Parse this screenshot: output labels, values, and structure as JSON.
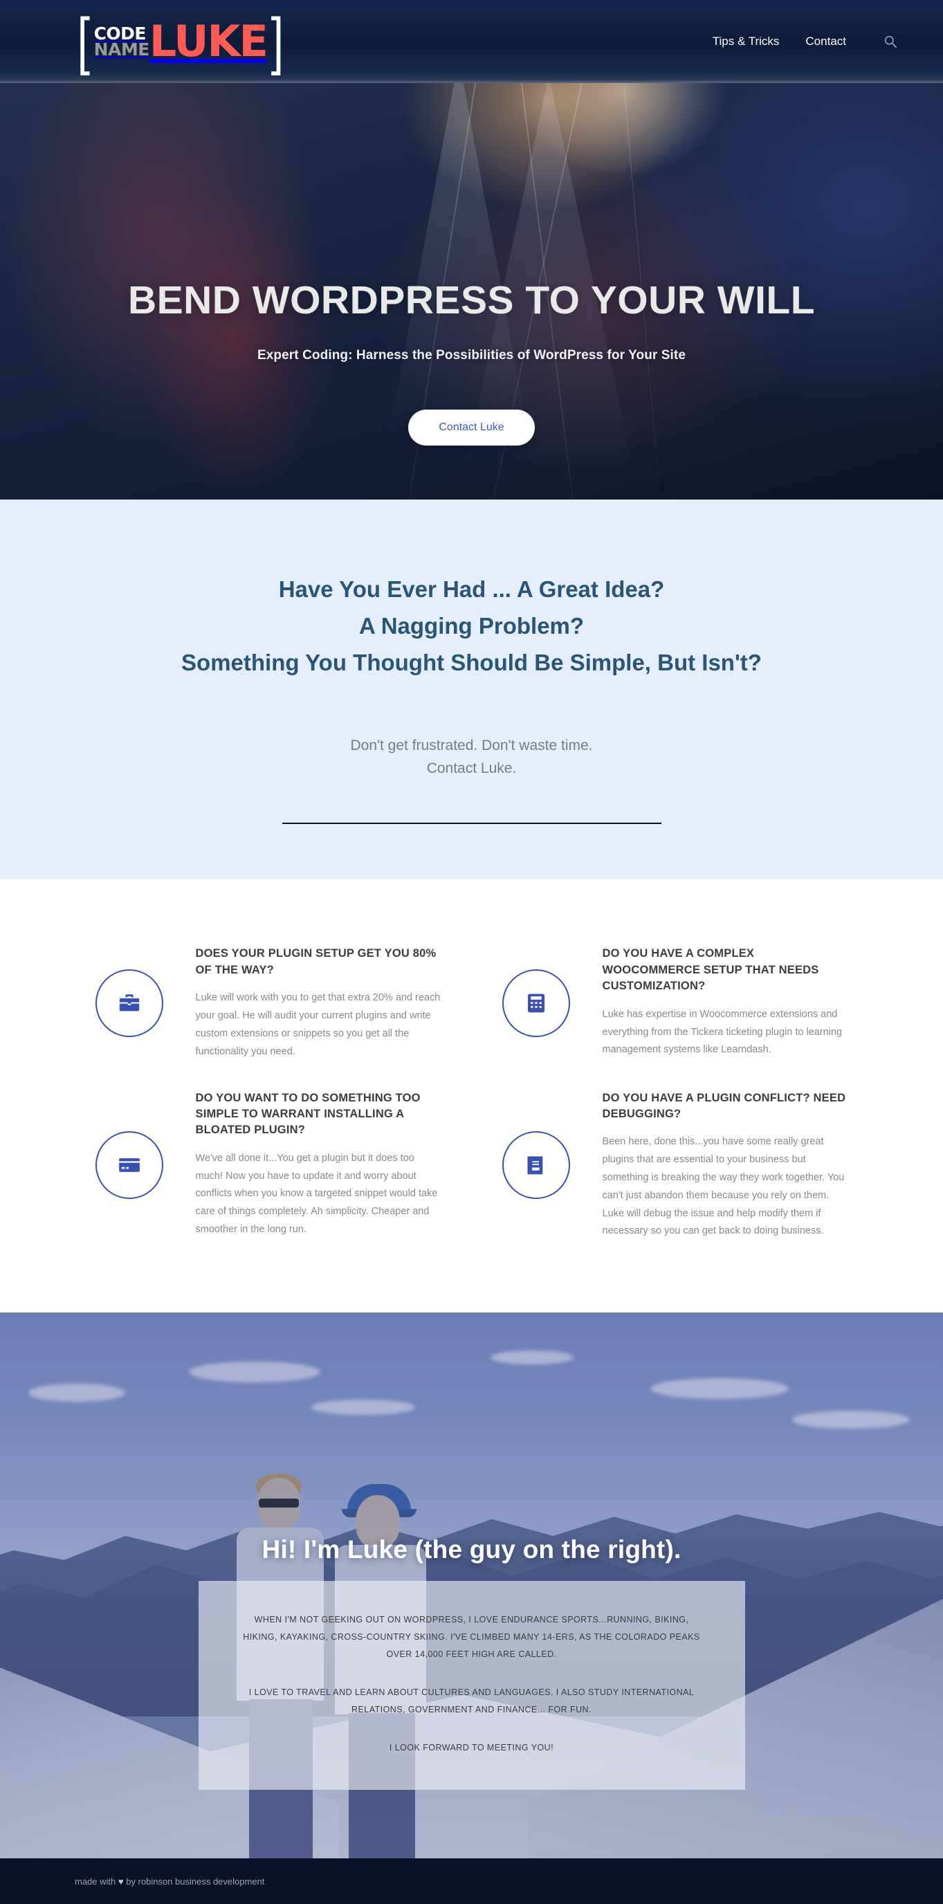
{
  "header": {
    "logo": {
      "bracket_left": "[",
      "bracket_right": "]",
      "code": "CODE",
      "name": "NAME",
      "luke": "LUKE"
    },
    "nav": [
      {
        "label": "Tips & Tricks"
      },
      {
        "label": "Contact"
      }
    ],
    "search_icon": "search-icon"
  },
  "hero": {
    "title": "BEND WORDPRESS TO YOUR WILL",
    "subtitle": "Expert Coding: Harness the Possibilities of WordPress for Your Site",
    "cta_label": "Contact Luke"
  },
  "intro": {
    "headings": [
      "Have You Ever Had ... A Great Idea?",
      "A Nagging Problem?",
      "Something You Thought Should Be Simple, But Isn't?"
    ],
    "note_line1": "Don't get frustrated. Don't waste time.",
    "note_line2": "Contact Luke."
  },
  "features": [
    {
      "icon": "briefcase-icon",
      "title": "DOES YOUR PLUGIN SETUP GET YOU 80% OF THE WAY?",
      "text": "Luke will work with you to get that extra 20% and reach your goal. He will audit your current plugins and write custom extensions or snippets so you get all the functionality you need."
    },
    {
      "icon": "calculator-icon",
      "title": "DO YOU HAVE A COMPLEX WOOCOMMERCE SETUP THAT NEEDS CUSTOMIZATION?",
      "text": "Luke has expertise in Woocommerce extensions and everything from the Tickera ticketing plugin to learning management systems like Learndash."
    },
    {
      "icon": "credit-card-icon",
      "title": "DO YOU WANT TO DO SOMETHING TOO SIMPLE TO WARRANT INSTALLING A BLOATED PLUGIN?",
      "text": "We've all done it...You get a plugin but it does too much! Now you have to update it and worry about conflicts when you know a targeted snippet would take care of things completely. Ah simplicity. Cheaper and smoother in the long run."
    },
    {
      "icon": "book-icon",
      "title": "DO YOU HAVE A PLUGIN CONFLICT? NEED DEBUGGING?",
      "text": "Been here, done this...you have some really great plugins that are essential to your business but something is breaking the way they work together. You can't just abandon them because you rely on them. Luke will debug the issue and help modify them if necessary so you can get back to doing business."
    }
  ],
  "about": {
    "title": "Hi! I'm Luke (the guy on the right).",
    "paragraphs": [
      "WHEN I'M NOT GEEKING OUT ON WORDPRESS, I LOVE ENDURANCE SPORTS...RUNNING, BIKING, HIKING, KAYAKING, CROSS-COUNTRY SKIING. I'VE CLIMBED MANY 14-ERS, AS THE COLORADO PEAKS OVER 14,000 FEET HIGH ARE CALLED.",
      "I LOVE TO TRAVEL AND LEARN ABOUT CULTURES AND LANGUAGES. I ALSO STUDY INTERNATIONAL RELATIONS, GOVERNMENT AND FINANCE... FOR FUN.",
      "I LOOK FORWARD TO MEETING YOU!"
    ]
  },
  "footer": {
    "prefix": "made with ",
    "heart": "♥",
    "suffix": " by robinson business development"
  },
  "colors": {
    "header_bg": "#0f1f40",
    "logo_accent": "#ff5a53",
    "intro_bg": "#e5effb",
    "intro_heading": "#2a5576",
    "icon_blue": "#3b50b5",
    "cta_text": "#4055c8",
    "footer_bg": "#0b1128"
  }
}
